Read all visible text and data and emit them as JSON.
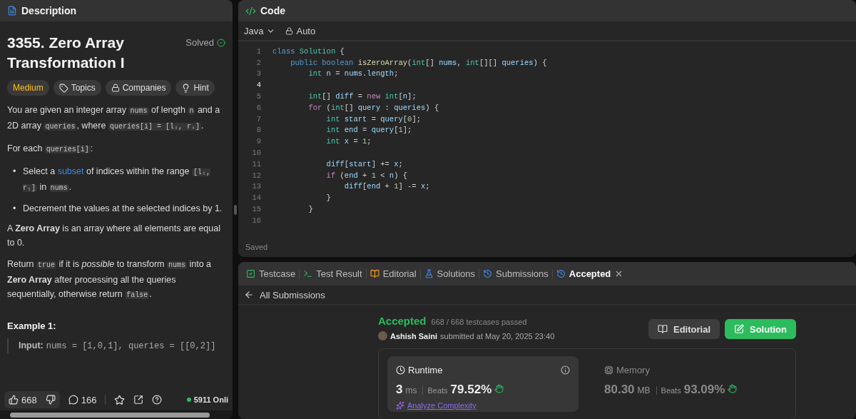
{
  "description_panel": {
    "tab": "Description",
    "title": "3355. Zero Array Transformation I",
    "status": "Solved",
    "tags": [
      {
        "label": "Medium",
        "kind": "difficulty"
      },
      {
        "label": "Topics",
        "kind": "tag"
      },
      {
        "label": "Companies",
        "kind": "lock"
      },
      {
        "label": "Hint",
        "kind": "bulb"
      }
    ],
    "content": [
      {
        "kind": "paragraph",
        "segments": [
          {
            "kind": "text",
            "text": "You are given an integer array "
          },
          {
            "kind": "code",
            "text": "nums"
          },
          {
            "kind": "text",
            "text": " of length "
          },
          {
            "kind": "code",
            "text": "n"
          },
          {
            "kind": "text",
            "text": " and a 2D array "
          },
          {
            "kind": "code",
            "text": "queries"
          },
          {
            "kind": "text",
            "text": ", where "
          },
          {
            "kind": "code",
            "text": "queries[i] = [lᵢ, rᵢ]"
          },
          {
            "kind": "text",
            "text": "."
          }
        ]
      },
      {
        "kind": "paragraph",
        "segments": [
          {
            "kind": "text",
            "text": "For each "
          },
          {
            "kind": "code",
            "text": "queries[i]"
          },
          {
            "kind": "text",
            "text": ":"
          }
        ]
      },
      {
        "kind": "bullets",
        "items": [
          {
            "marker": "•",
            "segments": [
              {
                "kind": "text",
                "text": "Select a "
              },
              {
                "kind": "link",
                "text": "subset"
              },
              {
                "kind": "text",
                "text": " of indices within the range "
              },
              {
                "kind": "code",
                "text": "[lᵢ, rᵢ]"
              },
              {
                "kind": "text",
                "text": " in "
              },
              {
                "kind": "code",
                "text": "nums"
              },
              {
                "kind": "text",
                "text": "."
              }
            ]
          },
          {
            "marker": "•",
            "segments": [
              {
                "kind": "text",
                "text": "Decrement the values at the selected indices by 1."
              }
            ]
          }
        ]
      },
      {
        "kind": "paragraph",
        "segments": [
          {
            "kind": "text",
            "text": "A "
          },
          {
            "kind": "bold",
            "text": "Zero Array"
          },
          {
            "kind": "text",
            "text": " is an array where all elements are equal to 0."
          }
        ]
      },
      {
        "kind": "paragraph",
        "segments": [
          {
            "kind": "text",
            "text": "Return "
          },
          {
            "kind": "code",
            "text": "true"
          },
          {
            "kind": "text",
            "text": " if it is "
          },
          {
            "kind": "italic",
            "text": "possible"
          },
          {
            "kind": "text",
            "text": " to transform "
          },
          {
            "kind": "code",
            "text": "nums"
          },
          {
            "kind": "text",
            "text": " into a "
          },
          {
            "kind": "bold",
            "text": "Zero Array"
          },
          {
            "kind": "text",
            "text": " after processing all the queries sequentially, otherwise return "
          },
          {
            "kind": "code",
            "text": "false"
          },
          {
            "kind": "text",
            "text": "."
          }
        ]
      },
      {
        "kind": "heading",
        "text": "Example 1:"
      },
      {
        "kind": "example",
        "label": "Input:",
        "code": "nums = [1,0,1], queries = [[0,2]]"
      }
    ],
    "footer": {
      "likes": "668",
      "comments": "166",
      "online": "5911 Onli"
    }
  },
  "code_panel": {
    "title": "Code",
    "language": "Java",
    "mode": "Auto",
    "status": "Saved",
    "lines": [
      {
        "number": "1",
        "active": false,
        "tokens": [
          {
            "kind": "kw",
            "text": "class"
          },
          {
            "kind": "type",
            "text": " Solution"
          },
          {
            "kind": "p",
            "text": " {"
          }
        ]
      },
      {
        "number": "2",
        "active": false,
        "tokens": [
          {
            "kind": "kw",
            "text": "    public"
          },
          {
            "kind": "kw",
            "text": " boolean"
          },
          {
            "kind": "fn",
            "text": " isZeroArray"
          },
          {
            "kind": "p",
            "text": "("
          },
          {
            "kind": "type",
            "text": "int"
          },
          {
            "kind": "p",
            "text": "[]"
          },
          {
            "kind": "var",
            "text": " nums"
          },
          {
            "kind": "p",
            "text": ","
          },
          {
            "kind": "type",
            "text": " int"
          },
          {
            "kind": "p",
            "text": "[][]"
          },
          {
            "kind": "var",
            "text": " queries"
          },
          {
            "kind": "p",
            "text": ") {"
          }
        ]
      },
      {
        "number": "3",
        "active": false,
        "tokens": [
          {
            "kind": "type",
            "text": "        int"
          },
          {
            "kind": "var",
            "text": " n"
          },
          {
            "kind": "p",
            "text": " ="
          },
          {
            "kind": "var",
            "text": " nums"
          },
          {
            "kind": "p",
            "text": "."
          },
          {
            "kind": "var",
            "text": "length"
          },
          {
            "kind": "p",
            "text": ";"
          }
        ]
      },
      {
        "number": "4",
        "active": true
      },
      {
        "number": "5",
        "active": false,
        "tokens": [
          {
            "kind": "type",
            "text": "        int"
          },
          {
            "kind": "p",
            "text": "[]"
          },
          {
            "kind": "var",
            "text": " diff"
          },
          {
            "kind": "p",
            "text": " ="
          },
          {
            "kind": "ctrl",
            "text": " new"
          },
          {
            "kind": "type",
            "text": " int"
          },
          {
            "kind": "p",
            "text": "["
          },
          {
            "kind": "var",
            "text": "n"
          },
          {
            "kind": "p",
            "text": "];"
          }
        ]
      },
      {
        "number": "6",
        "active": false,
        "tokens": [
          {
            "kind": "ctrl",
            "text": "        for"
          },
          {
            "kind": "p",
            "text": " ("
          },
          {
            "kind": "type",
            "text": "int"
          },
          {
            "kind": "p",
            "text": "[]"
          },
          {
            "kind": "var",
            "text": " query"
          },
          {
            "kind": "p",
            "text": " :"
          },
          {
            "kind": "var",
            "text": " queries"
          },
          {
            "kind": "p",
            "text": ") {"
          }
        ]
      },
      {
        "number": "7",
        "active": false,
        "tokens": [
          {
            "kind": "type",
            "text": "            int"
          },
          {
            "kind": "var",
            "text": " start"
          },
          {
            "kind": "p",
            "text": " ="
          },
          {
            "kind": "var",
            "text": " query"
          },
          {
            "kind": "p",
            "text": "["
          },
          {
            "kind": "num",
            "text": "0"
          },
          {
            "kind": "p",
            "text": "];"
          }
        ]
      },
      {
        "number": "8",
        "active": false,
        "tokens": [
          {
            "kind": "type",
            "text": "            int"
          },
          {
            "kind": "var",
            "text": " end"
          },
          {
            "kind": "p",
            "text": " ="
          },
          {
            "kind": "var",
            "text": " query"
          },
          {
            "kind": "p",
            "text": "["
          },
          {
            "kind": "num",
            "text": "1"
          },
          {
            "kind": "p",
            "text": "];"
          }
        ]
      },
      {
        "number": "9",
        "active": false,
        "tokens": [
          {
            "kind": "type",
            "text": "            int"
          },
          {
            "kind": "var",
            "text": " x"
          },
          {
            "kind": "p",
            "text": " ="
          },
          {
            "kind": "num",
            "text": " 1"
          },
          {
            "kind": "p",
            "text": ";"
          }
        ]
      },
      {
        "number": "10",
        "active": false
      },
      {
        "number": "11",
        "active": false,
        "tokens": [
          {
            "kind": "var",
            "text": "            diff"
          },
          {
            "kind": "p",
            "text": "["
          },
          {
            "kind": "var",
            "text": "start"
          },
          {
            "kind": "p",
            "text": "] +="
          },
          {
            "kind": "var",
            "text": " x"
          },
          {
            "kind": "p",
            "text": ";"
          }
        ]
      },
      {
        "number": "12",
        "active": false,
        "tokens": [
          {
            "kind": "ctrl",
            "text": "            if"
          },
          {
            "kind": "p",
            "text": " ("
          },
          {
            "kind": "var",
            "text": "end"
          },
          {
            "kind": "p",
            "text": " +"
          },
          {
            "kind": "num",
            "text": " 1"
          },
          {
            "kind": "p",
            "text": " <"
          },
          {
            "kind": "var",
            "text": " n"
          },
          {
            "kind": "p",
            "text": ") {"
          }
        ]
      },
      {
        "number": "13",
        "active": false,
        "tokens": [
          {
            "kind": "var",
            "text": "                diff"
          },
          {
            "kind": "p",
            "text": "["
          },
          {
            "kind": "var",
            "text": "end"
          },
          {
            "kind": "p",
            "text": " +"
          },
          {
            "kind": "num",
            "text": " 1"
          },
          {
            "kind": "p",
            "text": "] -="
          },
          {
            "kind": "var",
            "text": " x"
          },
          {
            "kind": "p",
            "text": ";"
          }
        ]
      },
      {
        "number": "14",
        "active": false,
        "tokens": [
          {
            "kind": "p",
            "text": "            }"
          }
        ]
      },
      {
        "number": "15",
        "active": false,
        "tokens": [
          {
            "kind": "p",
            "text": "        }"
          }
        ]
      },
      {
        "number": "16",
        "active": false
      }
    ]
  },
  "result_panel": {
    "tabs": [
      {
        "label": "Testcase",
        "kind": "check",
        "selected": false,
        "closable": false
      },
      {
        "label": "Test Result",
        "kind": "terminal",
        "selected": false,
        "closable": false
      },
      {
        "label": "Editorial",
        "kind": "book",
        "selected": false,
        "closable": false
      },
      {
        "label": "Solutions",
        "kind": "flask",
        "selected": false,
        "closable": false
      },
      {
        "label": "Submissions",
        "kind": "history",
        "selected": false,
        "closable": false
      },
      {
        "label": "Accepted",
        "kind": "history",
        "selected": true,
        "closable": true
      }
    ],
    "back": "All Submissions",
    "result": {
      "verdict": "Accepted",
      "passed": "668 / 668 testcases passed",
      "user": "Ashish Saini",
      "submitted": "submitted at May 20, 2025 23:40"
    },
    "buttons": [
      {
        "label": "Editorial",
        "kind": "secondary"
      },
      {
        "label": "Solution",
        "kind": "primary"
      }
    ],
    "metrics": [
      {
        "kind": "runtime",
        "label": "Runtime",
        "value": "3",
        "unit": "ms",
        "beats_label": "Beats",
        "beats": "79.52%",
        "selected": true,
        "link": "Analyze Complexity"
      },
      {
        "kind": "memory",
        "label": "Memory",
        "value": "80.30",
        "unit": "MB",
        "beats_label": "Beats",
        "beats": "93.09%",
        "selected": false
      }
    ]
  }
}
